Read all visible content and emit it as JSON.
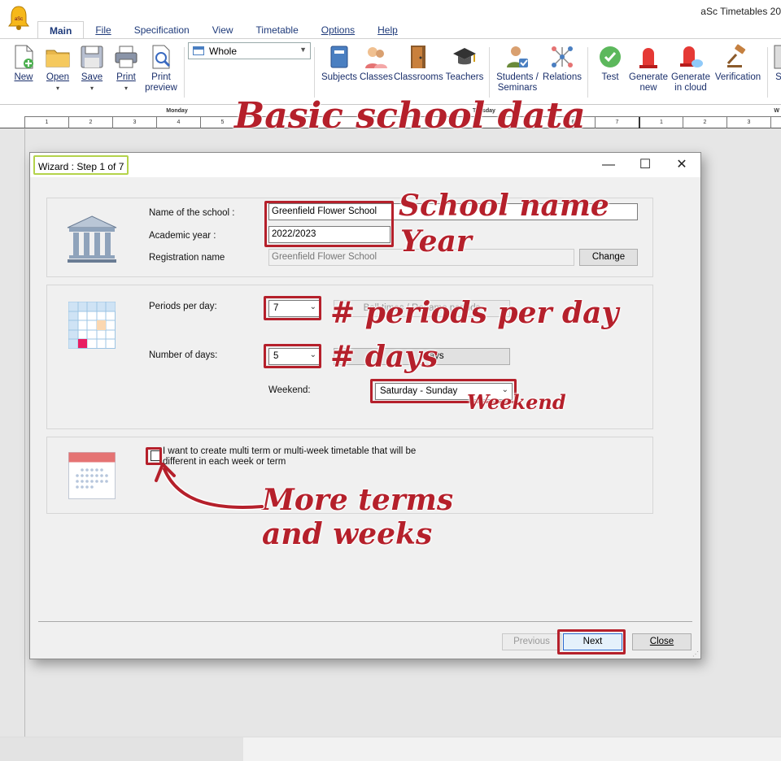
{
  "app": {
    "title": "aSc Timetables 20"
  },
  "menu": {
    "tabs": [
      "Main",
      "File",
      "Specification",
      "View",
      "Timetable",
      "Options",
      "Help"
    ]
  },
  "ribbon": {
    "new": "New",
    "open": "Open",
    "save": "Save",
    "print": "Print",
    "print_preview": [
      "Print",
      "preview"
    ],
    "view_combo": "Whole",
    "subjects": "Subjects",
    "classes": "Classes",
    "classrooms": "Classrooms",
    "teachers": "Teachers",
    "students": [
      "Students /",
      "Seminars"
    ],
    "relations": "Relations",
    "test": "Test",
    "generate_new": [
      "Generate",
      "new"
    ],
    "generate_cloud": [
      "Generate",
      "in cloud"
    ],
    "verification": "Verification",
    "cut": "S"
  },
  "timetable": {
    "days": [
      "Monday",
      "Tuesday",
      "W"
    ],
    "periods": [
      "1",
      "2",
      "3",
      "4",
      "5",
      "6",
      "7"
    ]
  },
  "dialog": {
    "title": "Wizard : Step 1 of 7",
    "school_label": "Name of the school :",
    "school_value": "Greenfield Flower School",
    "year_label": "Academic year :",
    "year_value": "2022/2023",
    "reg_label": "Registration name",
    "reg_value": "Greenfield Flower School",
    "change_button": "Change",
    "periods_label": "Periods per day:",
    "periods_value": "7",
    "bell_button": "Bell times / Rename periods",
    "days_label": "Number of days:",
    "days_value": "5",
    "days_button": "days",
    "weekend_label": "Weekend:",
    "weekend_value": "Saturday - Sunday",
    "multiterm_text": [
      "I want to create multi term or multi-week timetable that will be",
      "different in each week or term"
    ],
    "previous_button": "Previous",
    "next_button": "Next",
    "close_button": "Close"
  },
  "annotations": {
    "headline": "Basic school data",
    "school_name": "School name",
    "year": "Year",
    "periods": "# periods per day",
    "days": "# days",
    "weekend": "Weekend",
    "more_terms": [
      "More terms",
      "and weeks"
    ]
  },
  "colors": {
    "annotation": "#b5202b",
    "title_highlight": "#b4d34b",
    "next_focus": "#2d6bd0"
  }
}
